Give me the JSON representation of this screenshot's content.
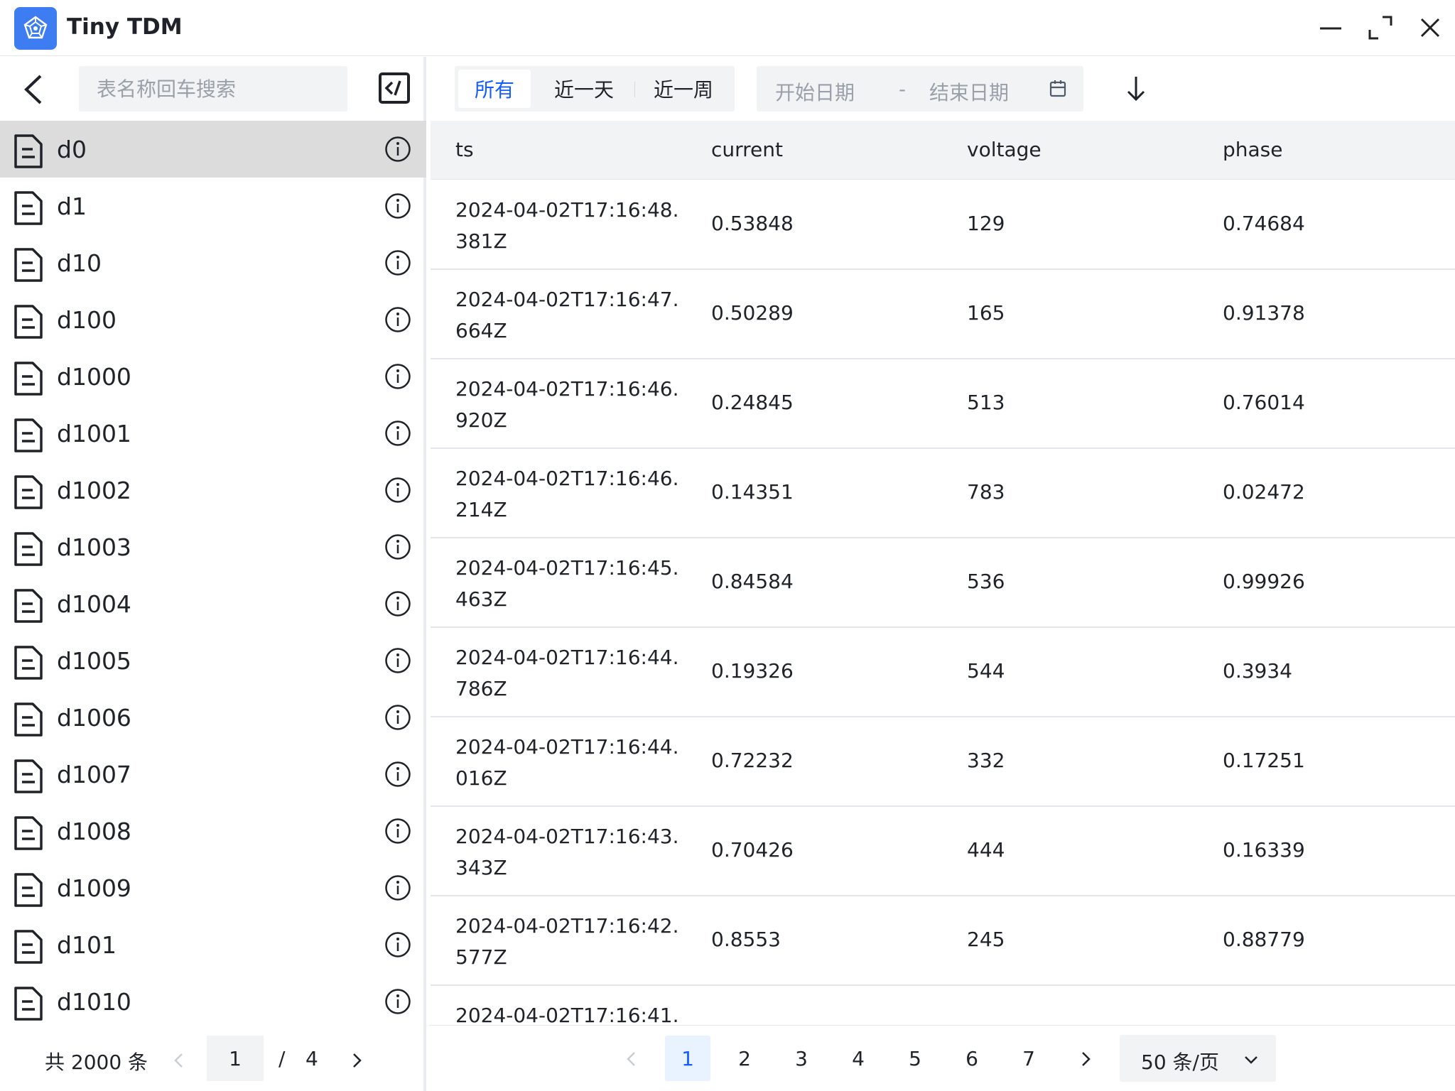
{
  "app": {
    "title": "Tiny TDM"
  },
  "left": {
    "search_placeholder": "表名称回车搜索",
    "tables": [
      {
        "name": "d0",
        "active": true
      },
      {
        "name": "d1"
      },
      {
        "name": "d10"
      },
      {
        "name": "d100"
      },
      {
        "name": "d1000"
      },
      {
        "name": "d1001"
      },
      {
        "name": "d1002"
      },
      {
        "name": "d1003"
      },
      {
        "name": "d1004"
      },
      {
        "name": "d1005"
      },
      {
        "name": "d1006"
      },
      {
        "name": "d1007"
      },
      {
        "name": "d1008"
      },
      {
        "name": "d1009"
      },
      {
        "name": "d101"
      },
      {
        "name": "d1010"
      }
    ],
    "pager": {
      "total_text": "共 2000 条",
      "current_page": "1",
      "separator": "/",
      "total_pages": "4"
    }
  },
  "filter": {
    "tabs": [
      {
        "label": "所有",
        "active": true
      },
      {
        "label": "近一天"
      },
      {
        "label": "近一周"
      }
    ],
    "start_placeholder": "开始日期",
    "end_placeholder": "结束日期",
    "range_separator": "-"
  },
  "grid": {
    "columns": [
      "ts",
      "current",
      "voltage",
      "phase"
    ],
    "rows": [
      {
        "ts_line1": "2024-04-02T17:16:48.",
        "ts_line2": "381Z",
        "current": "0.53848",
        "voltage": "129",
        "phase": "0.74684"
      },
      {
        "ts_line1": "2024-04-02T17:16:47.",
        "ts_line2": "664Z",
        "current": "0.50289",
        "voltage": "165",
        "phase": "0.91378"
      },
      {
        "ts_line1": "2024-04-02T17:16:46.",
        "ts_line2": "920Z",
        "current": "0.24845",
        "voltage": "513",
        "phase": "0.76014"
      },
      {
        "ts_line1": "2024-04-02T17:16:46.",
        "ts_line2": "214Z",
        "current": "0.14351",
        "voltage": "783",
        "phase": "0.02472"
      },
      {
        "ts_line1": "2024-04-02T17:16:45.",
        "ts_line2": "463Z",
        "current": "0.84584",
        "voltage": "536",
        "phase": "0.99926"
      },
      {
        "ts_line1": "2024-04-02T17:16:44.",
        "ts_line2": "786Z",
        "current": "0.19326",
        "voltage": "544",
        "phase": "0.3934"
      },
      {
        "ts_line1": "2024-04-02T17:16:44.",
        "ts_line2": "016Z",
        "current": "0.72232",
        "voltage": "332",
        "phase": "0.17251"
      },
      {
        "ts_line1": "2024-04-02T17:16:43.",
        "ts_line2": "343Z",
        "current": "0.70426",
        "voltage": "444",
        "phase": "0.16339"
      },
      {
        "ts_line1": "2024-04-02T17:16:42.",
        "ts_line2": "577Z",
        "current": "0.8553",
        "voltage": "245",
        "phase": "0.88779"
      },
      {
        "ts_line1": "2024-04-02T17:16:41.",
        "ts_line2": "",
        "current": "",
        "voltage": "",
        "phase": ""
      }
    ]
  },
  "pager": {
    "pages": [
      "1",
      "2",
      "3",
      "4",
      "5",
      "6",
      "7"
    ],
    "current": "1",
    "page_size_label": "50 条/页"
  },
  "colors": {
    "accent": "#165dff",
    "logo": "#3d7df1",
    "selected_row": "#dcdcdc",
    "input_bg": "#f2f3f5"
  }
}
